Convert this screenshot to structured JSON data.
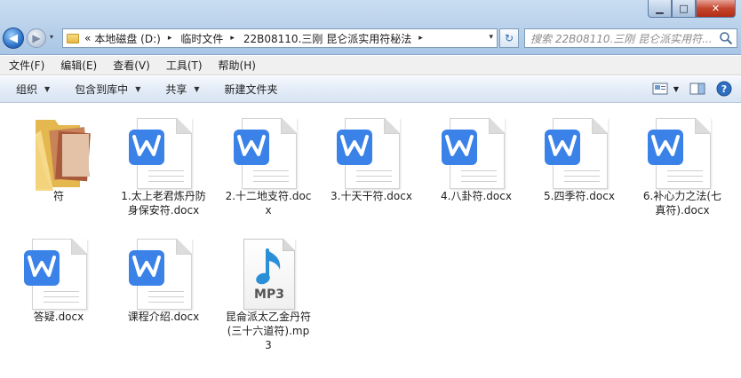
{
  "window": {
    "controls": {
      "minimize": "▁",
      "maximize": "□",
      "close": "✕"
    }
  },
  "nav": {
    "back": "◀",
    "forward": "▶",
    "history": "▾"
  },
  "address": {
    "prefix": "«",
    "crumbs": [
      "本地磁盘 (D:)",
      "临时文件",
      "22B08110.三刚 昆仑派实用符秘法"
    ],
    "separator": "▸",
    "dropdown": "▾"
  },
  "refresh_glyph": "↻",
  "search": {
    "placeholder": "搜索 22B08110.三刚 昆仑派实用符..."
  },
  "menu": [
    "文件(F)",
    "编辑(E)",
    "查看(V)",
    "工具(T)",
    "帮助(H)"
  ],
  "commands": {
    "organize": "组织",
    "include_library": "包含到库中",
    "share": "共享",
    "new_folder": "新建文件夹",
    "caret": "▼"
  },
  "files": [
    {
      "name": "符",
      "type": "folder"
    },
    {
      "name": "1.太上老君炼丹防身保安符.docx",
      "type": "docx"
    },
    {
      "name": "2.十二地支符.docx",
      "type": "docx"
    },
    {
      "name": "3.十天干符.docx",
      "type": "docx"
    },
    {
      "name": "4.八卦符.docx",
      "type": "docx"
    },
    {
      "name": "5.四季符.docx",
      "type": "docx"
    },
    {
      "name": "6.补心力之法(七真符).docx",
      "type": "docx"
    },
    {
      "name": "答疑.docx",
      "type": "docx"
    },
    {
      "name": "课程介绍.docx",
      "type": "docx"
    },
    {
      "name": "昆侖派太乙金丹符(三十六道符).mp3",
      "type": "mp3",
      "badge": "MP3"
    }
  ],
  "colors": {
    "wps_blue": "#3b82e8",
    "folder_yellow": "#f2d37a",
    "mp3_note": "#2a8fd6"
  }
}
